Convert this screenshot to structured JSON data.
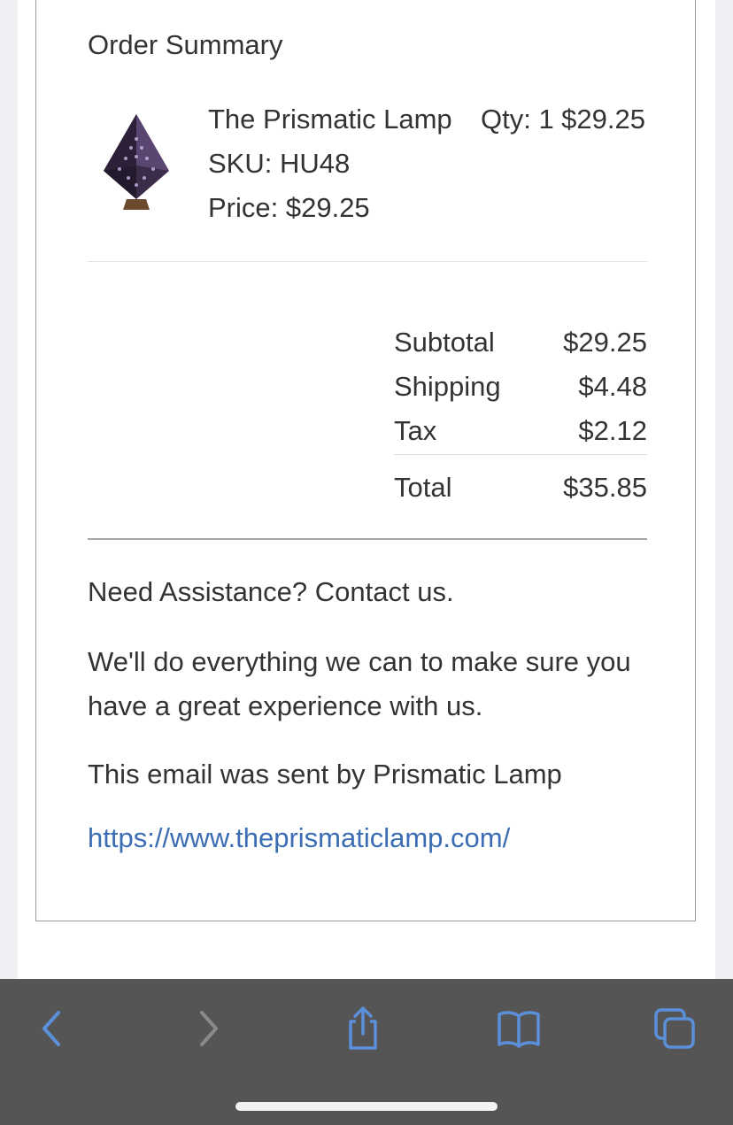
{
  "order_summary": {
    "title": "Order Summary",
    "item": {
      "name": "The Prismatic Lamp",
      "qty": "Qty: 1",
      "line_total": "$29.25",
      "sku": "SKU: HU48",
      "price": "Price: $29.25"
    },
    "totals": {
      "subtotal_label": "Subtotal",
      "subtotal_value": "$29.25",
      "shipping_label": "Shipping",
      "shipping_value": "$4.48",
      "tax_label": "Tax",
      "tax_value": "$2.12",
      "total_label": "Total",
      "total_value": "$35.85"
    }
  },
  "assistance": {
    "heading": "Need Assistance? Contact us.",
    "body": "We'll do everything we can to make sure you have a great experience with us."
  },
  "footer": {
    "sent_by": "This email was sent by Prismatic Lamp",
    "link": "https://www.theprismaticlamp.com/"
  },
  "toolbar": {
    "icons": [
      "back-icon",
      "forward-icon",
      "share-icon",
      "bookmarks-icon",
      "tabs-icon"
    ],
    "accent_color": "#5b8fd9",
    "disabled_color": "#8a8a8a"
  }
}
